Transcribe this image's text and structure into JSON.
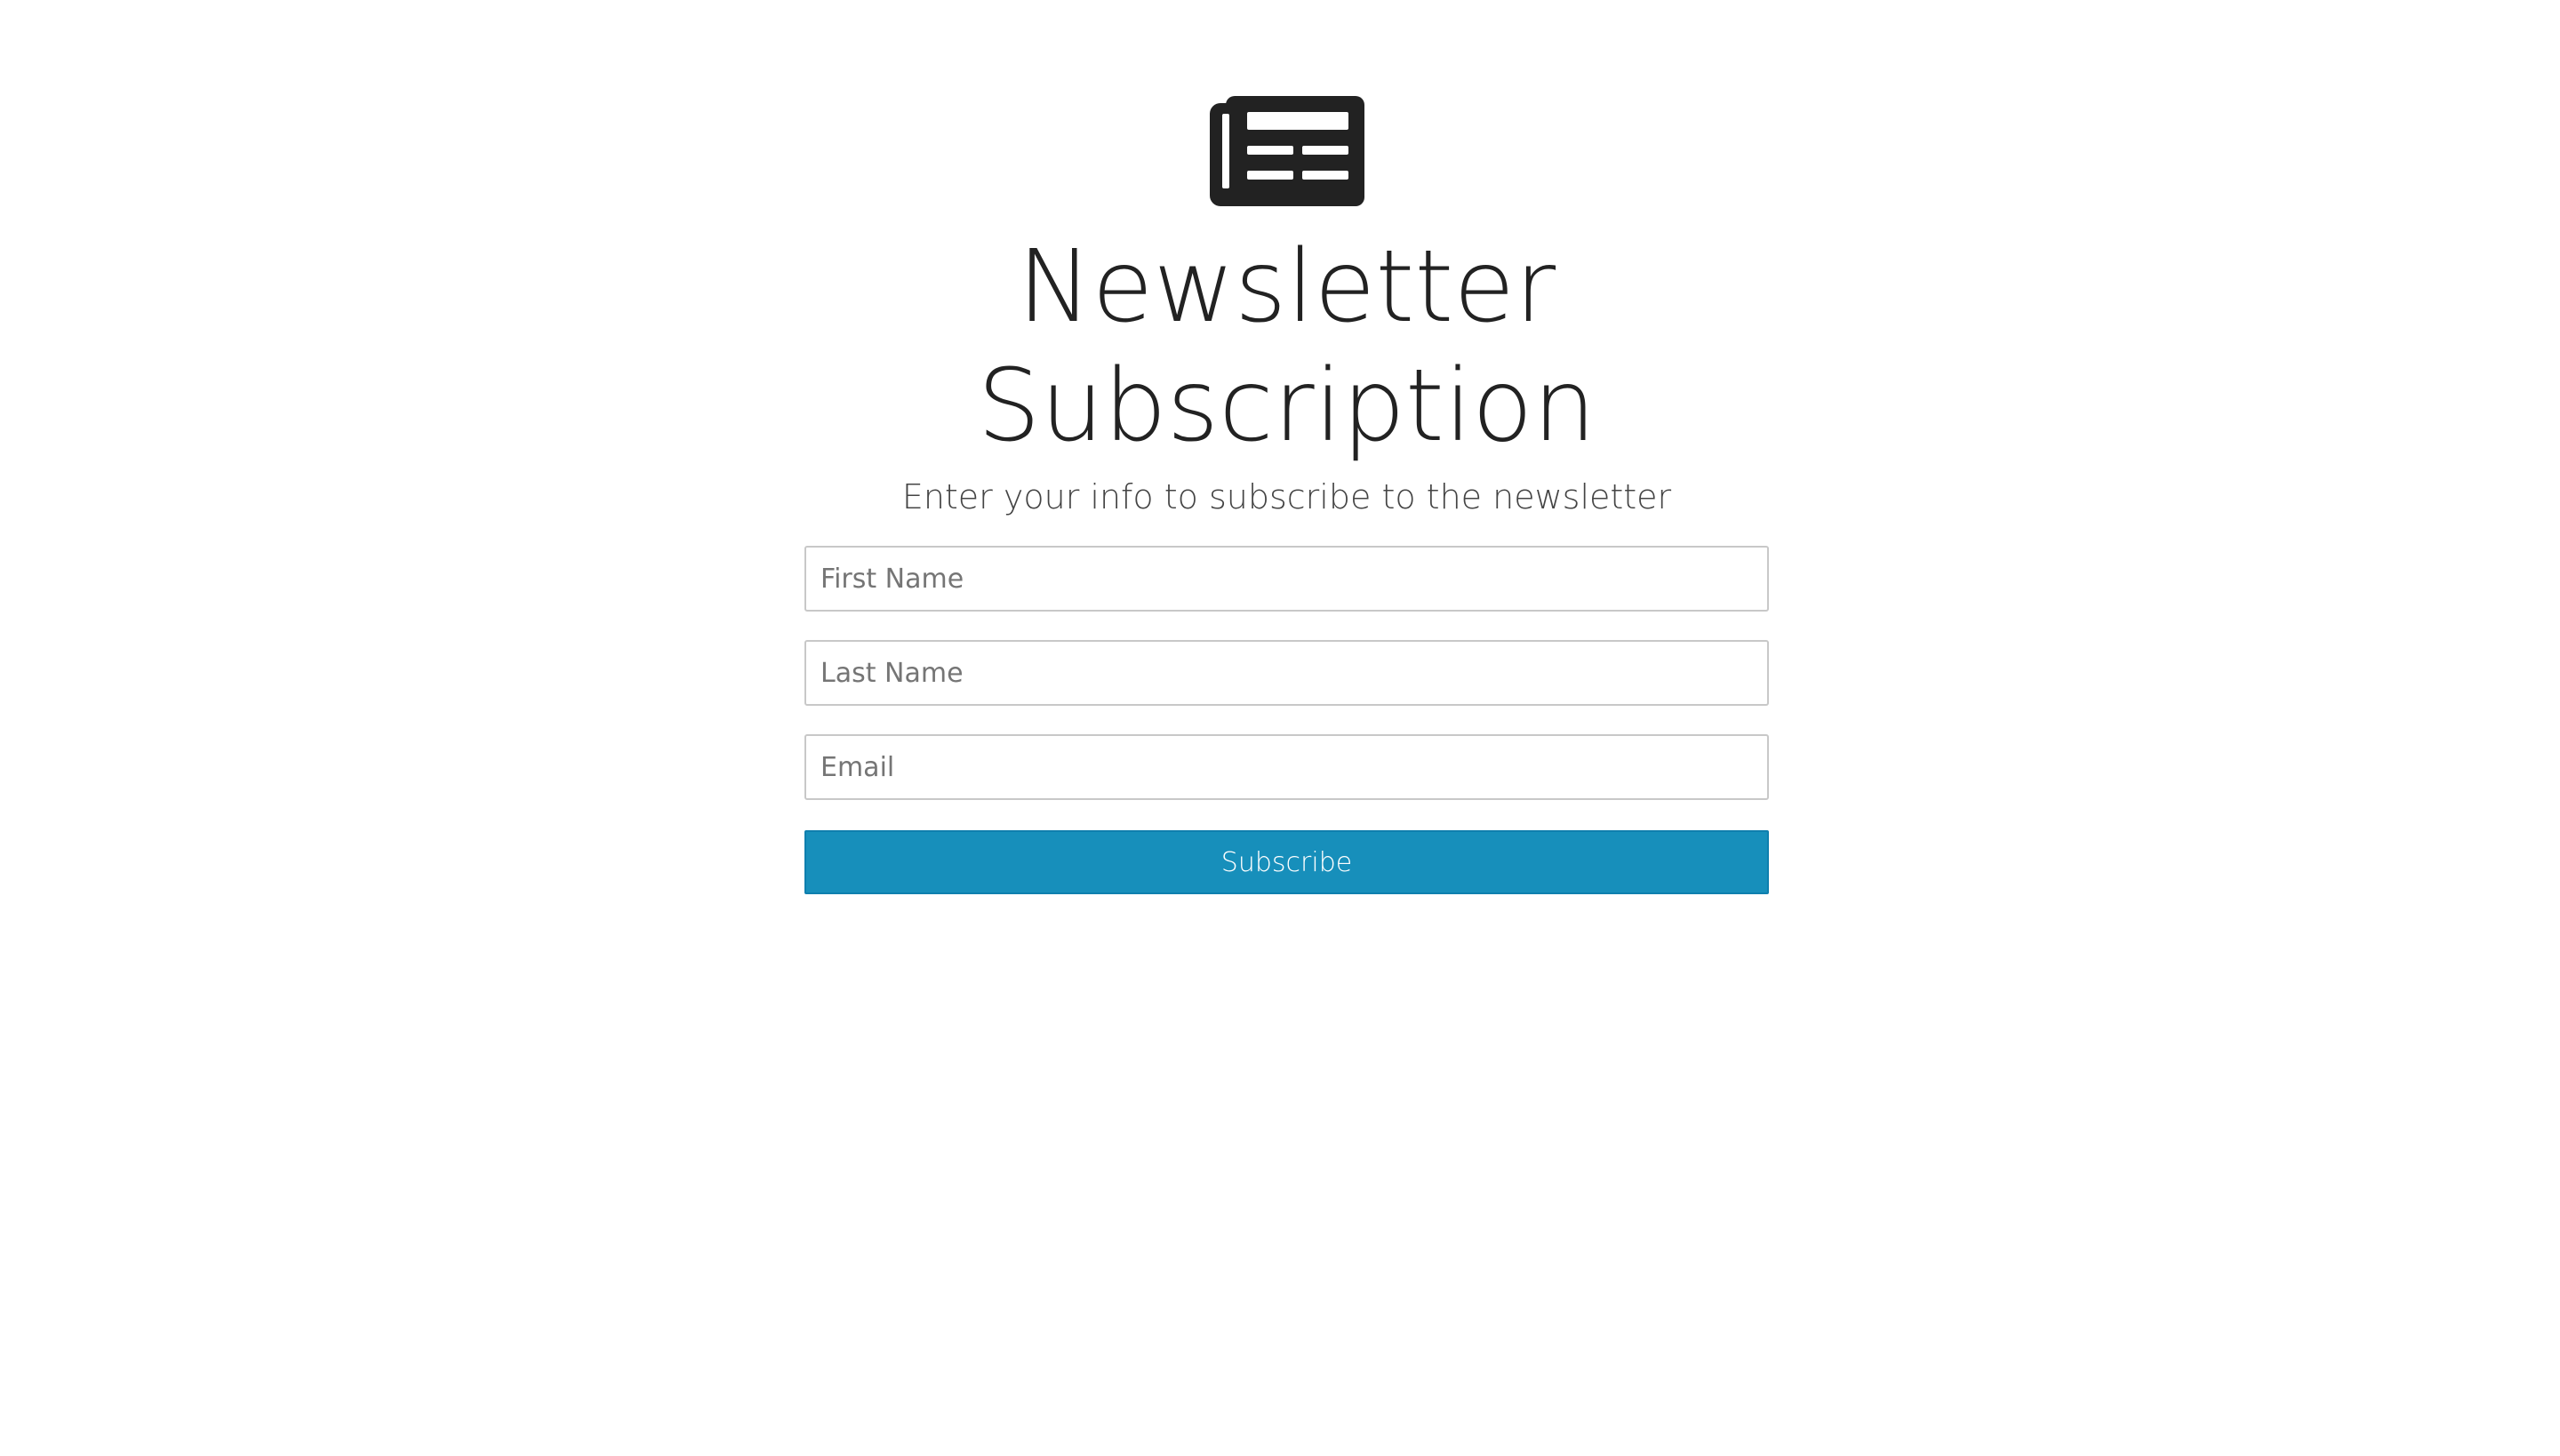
{
  "logo": {
    "icon": "newspaper-icon",
    "color": "#222222"
  },
  "header": {
    "title": "Newsletter Subscription",
    "subtitle": "Enter your info to subscribe to the newsletter"
  },
  "form": {
    "first_name": {
      "placeholder": "First Name",
      "value": ""
    },
    "last_name": {
      "placeholder": "Last Name",
      "value": ""
    },
    "email": {
      "placeholder": "Email",
      "value": ""
    },
    "submit_label": "Subscribe"
  },
  "colors": {
    "accent": "#178fbb",
    "text": "#222222",
    "border": "#c8c8c8"
  }
}
